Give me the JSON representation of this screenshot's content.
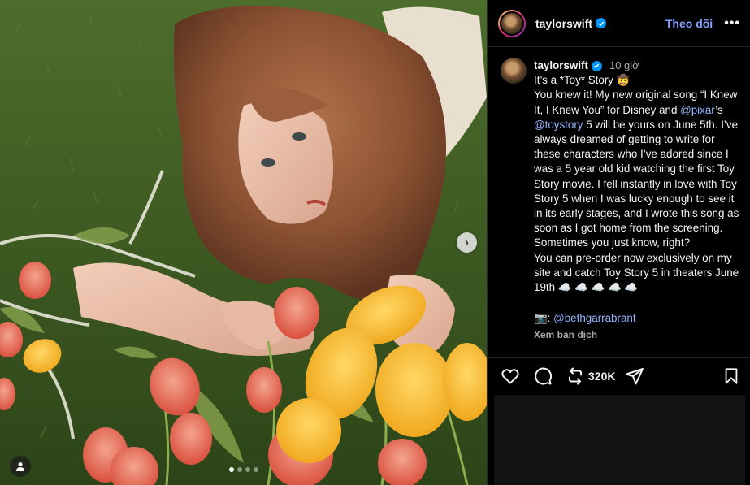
{
  "post": {
    "username": "taylorswift",
    "follow_label": "Theo dõi",
    "more_label": "•••",
    "time": "10 giờ",
    "caption": {
      "line1": "It’s a *Toy* Story 🤠",
      "p1_a": "You knew it! My new original song “I Knew It, I Knew You” for Disney and ",
      "mention_pixar": "@pixar",
      "p1_b": "’s ",
      "mention_toystory": "@toystory",
      "p1_c": " 5 will be yours on June 5th. I’ve always dreamed of getting to write for these characters who I’ve adored since I was a 5 year old kid watching the first Toy Story movie. I fell instantly in love with Toy Story 5 when I was lucky enough to see it in its early stages, and I wrote this song as soon as I got home from the screening. Sometimes you just know, right?",
      "p2": "You can pre-order now exclusively on my site and catch Toy Story 5 in theaters June 19th ☁️ ☁️ ☁️ ☁️ ☁️",
      "credit_prefix": "📷: ",
      "credit_mention": "@bethgarrabrant"
    },
    "translate_label": "Xem bản dịch",
    "share_count": "320K"
  },
  "carousel": {
    "total": 4,
    "active_index": 0,
    "next_glyph": "›"
  },
  "icons": [
    "avatar",
    "verified-badge",
    "heart-icon",
    "comment-icon",
    "repost-icon",
    "share-icon",
    "bookmark-icon",
    "user-tag-icon",
    "chevron-right-icon"
  ],
  "colors": {
    "accent_blue": "#0095f6",
    "link_blue": "#93b6ff",
    "follow": "#85a1ff",
    "muted": "#a8a8a8"
  }
}
